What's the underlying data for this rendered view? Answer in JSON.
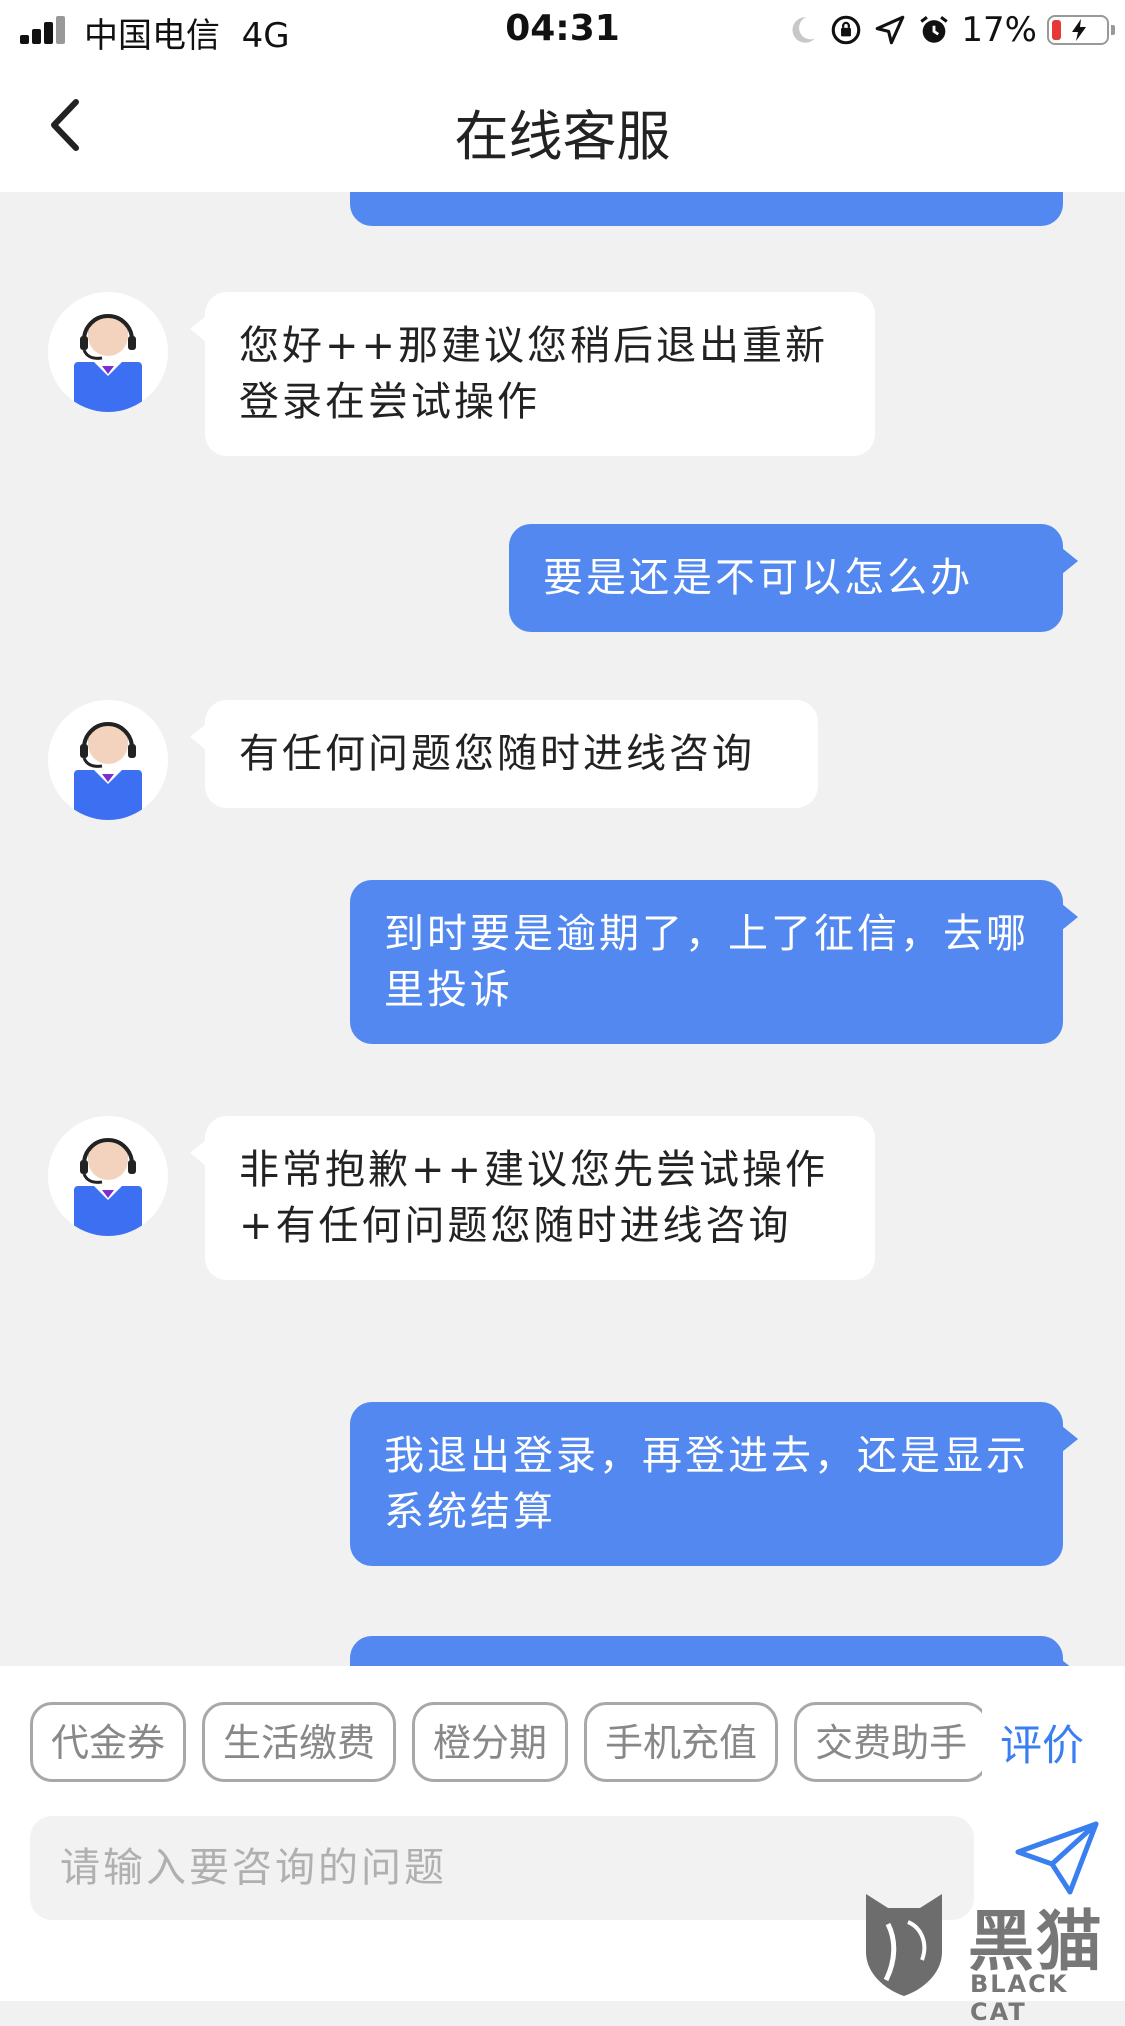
{
  "status_bar": {
    "carrier": "中国电信",
    "network": "4G",
    "time": "04:31",
    "battery_percent": "17%",
    "battery_level": 0.17,
    "icons": [
      "signal-icon",
      "moon-icon",
      "rotation-lock-icon",
      "location-icon",
      "alarm-icon",
      "battery-icon"
    ]
  },
  "header": {
    "title": "在线客服",
    "back_icon": "chevron-left-icon"
  },
  "messages": [
    {
      "from": "user",
      "text": ""
    },
    {
      "from": "agent",
      "text": "您好++那建议您稍后退出重新登录在尝试操作"
    },
    {
      "from": "user",
      "text": "要是还是不可以怎么办"
    },
    {
      "from": "agent",
      "text": "有任何问题您随时进线咨询"
    },
    {
      "from": "user",
      "text": "到时要是逾期了，上了征信，去哪里投诉"
    },
    {
      "from": "agent",
      "text": "非常抱歉++建议您先尝试操作+有任何问题您随时进线咨询"
    },
    {
      "from": "user",
      "text": "我退出登录，再登进去，还是显示系统结算"
    },
    {
      "from": "user",
      "text": ""
    }
  ],
  "quick_actions": [
    "代金券",
    "生活缴费",
    "橙分期",
    "手机充值",
    "交费助手"
  ],
  "rate_label": "评价",
  "composer": {
    "placeholder": "请输入要咨询的问题",
    "value": "",
    "send_icon": "send-icon"
  },
  "watermark": {
    "text": "黑猫",
    "en": "BLACK CAT"
  },
  "colors": {
    "user_bubble": "#5288ef",
    "agent_bubble": "#ffffff",
    "background": "#f1f1f2",
    "accent": "#3a7ff0"
  }
}
